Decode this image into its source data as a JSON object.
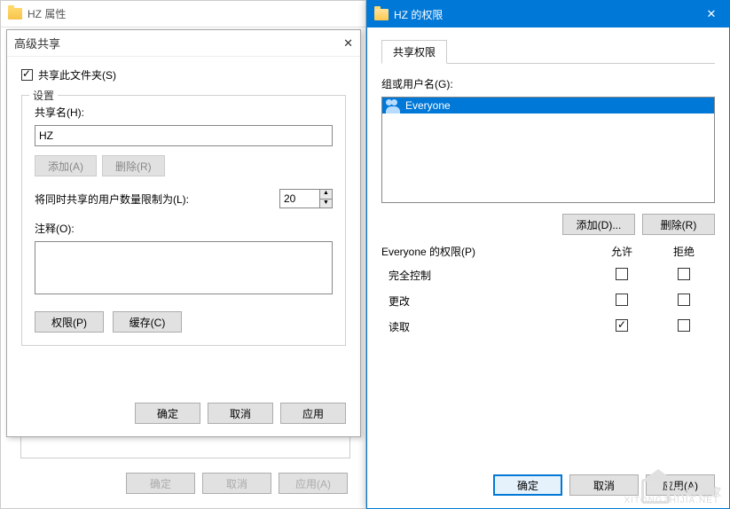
{
  "props": {
    "title": "HZ 属性",
    "advanced_title": "高级共享",
    "share_checkbox": "共享此文件夹(S)",
    "settings_label": "设置",
    "share_name_label": "共享名(H):",
    "share_name_value": "HZ",
    "add_btn": "添加(A)",
    "remove_btn": "删除(R)",
    "limit_label": "将同时共享的用户数量限制为(L):",
    "limit_value": "20",
    "comment_label": "注释(O):",
    "perm_btn": "权限(P)",
    "cache_btn": "缓存(C)",
    "ok": "确定",
    "cancel": "取消",
    "apply": "应用",
    "back_ok": "确定",
    "back_cancel": "取消",
    "back_apply": "应用(A)"
  },
  "perm": {
    "title": "HZ 的权限",
    "tab": "共享权限",
    "group_label": "组或用户名(G):",
    "everyone": "Everyone",
    "add_btn": "添加(D)...",
    "remove_btn": "删除(R)",
    "table_header": "Everyone 的权限(P)",
    "allow": "允许",
    "deny": "拒绝",
    "rows": [
      {
        "name": "完全控制",
        "allow": false,
        "deny": false
      },
      {
        "name": "更改",
        "allow": false,
        "deny": false
      },
      {
        "name": "读取",
        "allow": true,
        "deny": false
      }
    ],
    "ok": "确定",
    "cancel": "取消",
    "apply": "应用(A)"
  },
  "watermark": {
    "text": "系统之家",
    "sub": "XITONGZHIJIA.NET"
  }
}
